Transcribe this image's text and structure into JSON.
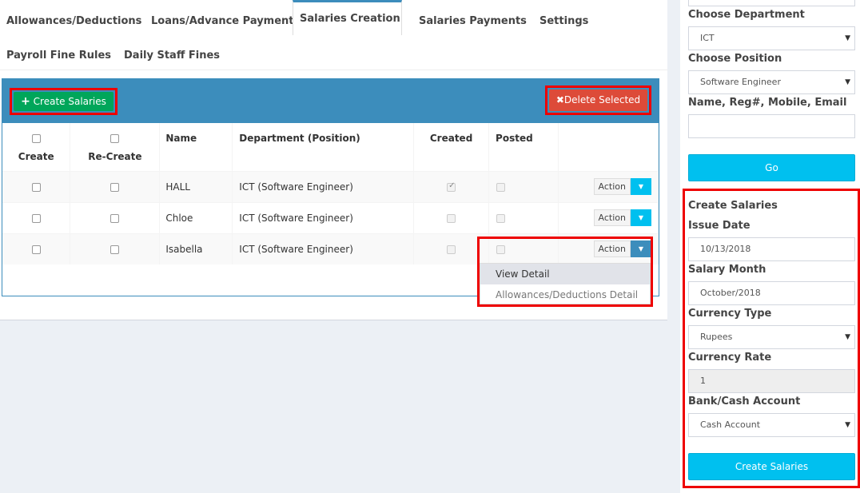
{
  "tabs": [
    {
      "label": "Allowances/Deductions"
    },
    {
      "label": "Loans/Advance Payments"
    },
    {
      "label": "Salaries Creation"
    },
    {
      "label": "Salaries Payments"
    },
    {
      "label": "Settings"
    },
    {
      "label": "Payroll Fine Rules"
    },
    {
      "label": "Daily Staff Fines"
    }
  ],
  "toolbar": {
    "create_label": "Create Salaries",
    "delete_label": "Delete Selected"
  },
  "table": {
    "headers": {
      "create": "Create",
      "recreate": "Re-Create",
      "name": "Name",
      "department": "Department (Position)",
      "created": "Created",
      "posted": "Posted"
    },
    "rows": [
      {
        "name": "HALL",
        "department": "ICT (Software Engineer)",
        "action": "Action"
      },
      {
        "name": "Chloe",
        "department": "ICT (Software Engineer)",
        "action": "Action"
      },
      {
        "name": "Isabella",
        "department": "ICT (Software Engineer)",
        "action": "Action"
      }
    ]
  },
  "dropdown": {
    "items": [
      "View Detail",
      "Allowances/Deductions Detail"
    ]
  },
  "sidebar": {
    "department_label": "Choose Department",
    "department_value": "ICT",
    "position_label": "Choose Position",
    "position_value": "Software Engineer",
    "search_label": "Name, Reg#, Mobile, Email",
    "search_value": "",
    "go_label": "Go",
    "create_section_title": "Create Salaries",
    "issue_date_label": "Issue Date",
    "issue_date_value": "10/13/2018",
    "salary_month_label": "Salary Month",
    "salary_month_value": "October/2018",
    "currency_type_label": "Currency Type",
    "currency_type_value": "Rupees",
    "currency_rate_label": "Currency Rate",
    "currency_rate_value": "1",
    "bank_label": "Bank/Cash Account",
    "bank_value": "Cash Account",
    "create_button_label": "Create Salaries"
  },
  "colors": {
    "primary": "#3c8dbc",
    "success": "#00a65a",
    "danger": "#dd4b39",
    "info": "#00c0ef",
    "highlight": "#ee0000"
  }
}
